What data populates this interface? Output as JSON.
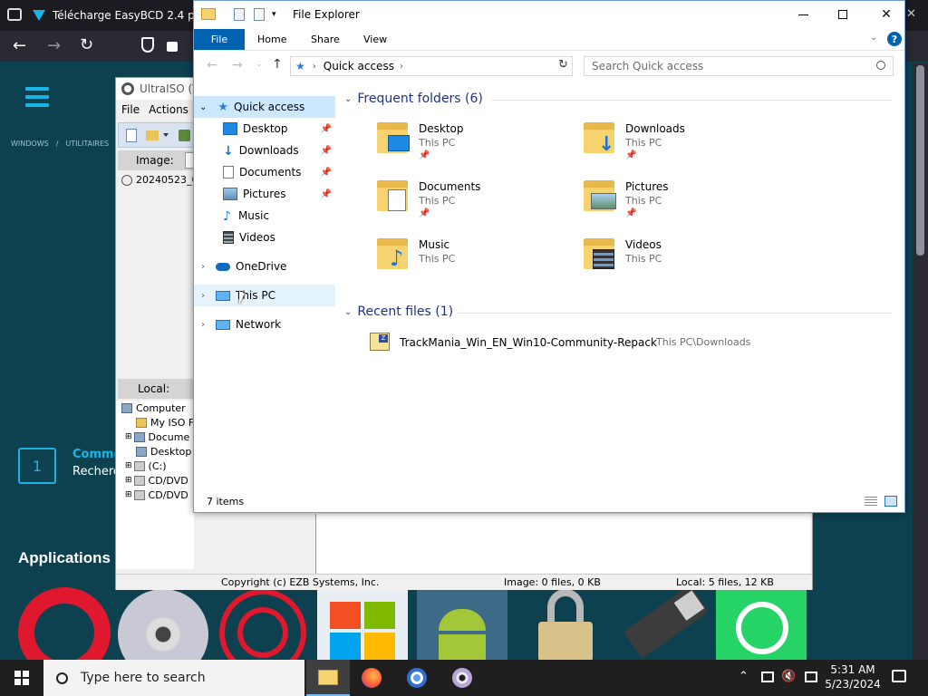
{
  "browser": {
    "active_tab_title": "Télécharge EasyBCD 2.4 pour",
    "close_glyph": "✕",
    "breadcrumb": [
      "WINDOWS",
      "/",
      "UTILITAIRES",
      "/"
    ],
    "step_number": "1",
    "step_title": "Comme",
    "step_text": "Recherc",
    "section_title": "Applications"
  },
  "ultraiso": {
    "title": "UltraISO (T",
    "menu": [
      "File",
      "Actions"
    ],
    "image_label": "Image:",
    "image_item": "20240523_0",
    "local_label": "Local:",
    "local_tree": [
      "Computer",
      "My ISO F",
      "Docume",
      "Desktop",
      "(C:)",
      "CD/DVD",
      "CD/DVD"
    ],
    "status_copyright": "Copyright (c) EZB Systems, Inc.",
    "status_image": "Image: 0 files, 0 KB",
    "status_local": "Local: 5 files, 12 KB"
  },
  "explorer": {
    "title": "File Explorer",
    "ribbon_tabs": [
      "File",
      "Home",
      "Share",
      "View"
    ],
    "address": "Quick access",
    "search_placeholder": "Search Quick access",
    "nav": {
      "quick_access": "Quick access",
      "pinned": [
        "Desktop",
        "Downloads",
        "Documents",
        "Pictures"
      ],
      "unpinned": [
        "Music",
        "Videos"
      ],
      "onedrive": "OneDrive",
      "this_pc": "This PC",
      "network": "Network"
    },
    "frequent_header": "Frequent folders (6)",
    "frequent": [
      {
        "name": "Desktop",
        "location": "This PC"
      },
      {
        "name": "Downloads",
        "location": "This PC"
      },
      {
        "name": "Documents",
        "location": "This PC"
      },
      {
        "name": "Pictures",
        "location": "This PC"
      },
      {
        "name": "Music",
        "location": "This PC"
      },
      {
        "name": "Videos",
        "location": "This PC"
      }
    ],
    "recent_header": "Recent files (1)",
    "recent": [
      {
        "name": "TrackMania_Win_EN_Win10-Community-Repack",
        "path": "This PC\\Downloads"
      }
    ],
    "status_items": "7 items"
  },
  "taskbar": {
    "search_placeholder": "Type here to search",
    "time": "5:31 AM",
    "date": "5/23/2024"
  },
  "colors": {
    "accent_blue": "#0063b1",
    "selection": "#cce8ff",
    "folder_yellow": "#f7d36f",
    "page_teal": "#0d4150",
    "brand_cyan": "#18b4e6"
  }
}
